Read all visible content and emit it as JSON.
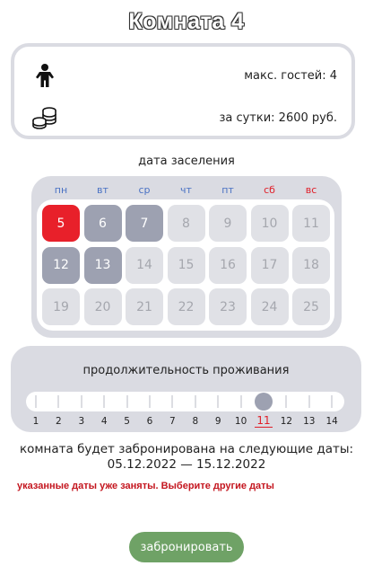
{
  "title": "Комната 4",
  "info": {
    "guests_icon": "person-icon",
    "guests_text": "макс. гостей: 4",
    "price_icon": "coins-icon",
    "price_text": "за сутки: 2600 руб."
  },
  "checkin_label": "дата заселения",
  "calendar": {
    "weekdays": [
      "пн",
      "вт",
      "ср",
      "чт",
      "пт",
      "сб",
      "вс"
    ],
    "weekend_color": "#e0202a",
    "weekday_color": "#4a72c4",
    "rows": [
      [
        {
          "day": "5",
          "state": "start"
        },
        {
          "day": "6",
          "state": "past"
        },
        {
          "day": "7",
          "state": "past"
        },
        {
          "day": "8",
          "state": "available"
        },
        {
          "day": "9",
          "state": "available"
        },
        {
          "day": "10",
          "state": "available"
        },
        {
          "day": "11",
          "state": "available"
        }
      ],
      [
        {
          "day": "12",
          "state": "past"
        },
        {
          "day": "13",
          "state": "past"
        },
        {
          "day": "14",
          "state": "available"
        },
        {
          "day": "15",
          "state": "available"
        },
        {
          "day": "16",
          "state": "available"
        },
        {
          "day": "17",
          "state": "available"
        },
        {
          "day": "18",
          "state": "available"
        }
      ],
      [
        {
          "day": "19",
          "state": "available"
        },
        {
          "day": "20",
          "state": "available"
        },
        {
          "day": "21",
          "state": "available"
        },
        {
          "day": "22",
          "state": "available"
        },
        {
          "day": "23",
          "state": "available"
        },
        {
          "day": "24",
          "state": "available"
        },
        {
          "day": "25",
          "state": "available"
        }
      ]
    ]
  },
  "duration": {
    "label": "продолжительность проживания",
    "ticks": [
      "1",
      "2",
      "3",
      "4",
      "5",
      "6",
      "7",
      "8",
      "9",
      "10",
      "11",
      "12",
      "13",
      "14"
    ],
    "selected": "11"
  },
  "summary": {
    "line1": "комната будет забронирована на следующие даты:",
    "line2": "05.12.2022 — 15.12.2022"
  },
  "warning": "указанные даты уже заняты. Выберите другие даты",
  "book_button": "забронировать",
  "colors": {
    "start": "#e8202a",
    "past": "#9da1b1",
    "available": "#e0e1e6",
    "button": "#6fa266",
    "warning": "#c4161f"
  }
}
